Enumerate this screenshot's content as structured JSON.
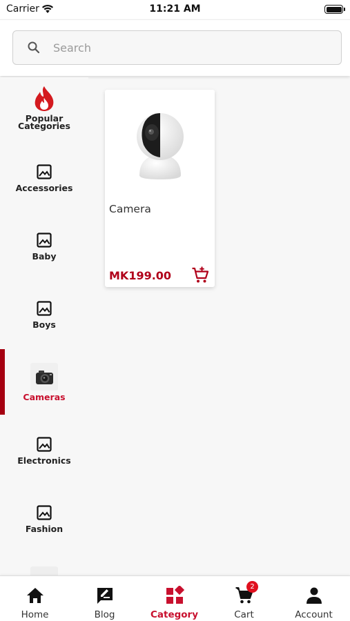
{
  "status_bar": {
    "carrier": "Carrier",
    "time": "11:21 AM"
  },
  "search": {
    "placeholder": "Search"
  },
  "categories": [
    {
      "label": "Popular Categories",
      "icon": "fire-icon"
    },
    {
      "label": "Accessories",
      "icon": "image-placeholder-icon"
    },
    {
      "label": "Baby",
      "icon": "image-placeholder-icon"
    },
    {
      "label": "Boys",
      "icon": "image-placeholder-icon"
    },
    {
      "label": "Cameras",
      "icon": "camera-thumbnail",
      "active": true
    },
    {
      "label": "Electronics",
      "icon": "image-placeholder-icon"
    },
    {
      "label": "Fashion",
      "icon": "image-placeholder-icon"
    }
  ],
  "products": [
    {
      "name": "Camera",
      "price": "MK199.00"
    }
  ],
  "bottom_nav": {
    "items": [
      {
        "label": "Home",
        "icon": "home-icon"
      },
      {
        "label": "Blog",
        "icon": "blog-icon"
      },
      {
        "label": "Category",
        "icon": "category-icon",
        "active": true
      },
      {
        "label": "Cart",
        "icon": "cart-icon"
      },
      {
        "label": "Account",
        "icon": "account-icon"
      }
    ],
    "cart_badge": "2"
  },
  "colors": {
    "accent": "#c8102e",
    "active_bar": "#a50011",
    "price": "#b0001a"
  }
}
